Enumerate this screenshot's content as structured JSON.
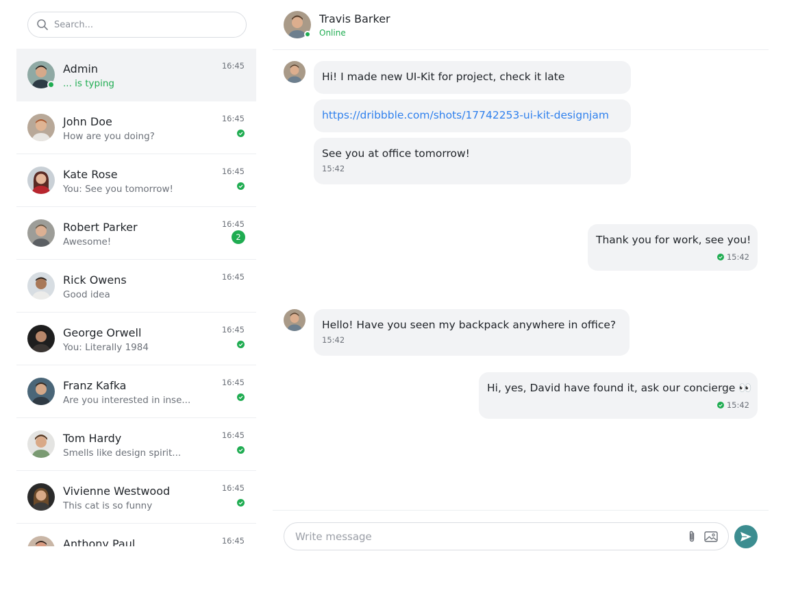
{
  "search": {
    "placeholder": "Search..."
  },
  "chats": [
    {
      "name": "Admin",
      "preview": "... is typing",
      "time": "16:45",
      "typing": true,
      "online": true,
      "status": "none"
    },
    {
      "name": "John Doe",
      "preview": "How are you doing?",
      "time": "16:45",
      "status": "read"
    },
    {
      "name": "Kate Rose",
      "preview": "You: See you tomorrow!",
      "time": "16:45",
      "status": "read"
    },
    {
      "name": "Robert Parker",
      "preview": "Awesome!",
      "time": "16:45",
      "status": "unread",
      "unread_count": "2"
    },
    {
      "name": "Rick Owens",
      "preview": "Good idea",
      "time": "16:45",
      "status": "none"
    },
    {
      "name": "George Orwell",
      "preview": "You: Literally 1984",
      "time": "16:45",
      "status": "read"
    },
    {
      "name": "Franz Kafka",
      "preview": "Are you interested in inse...",
      "time": "16:45",
      "status": "read"
    },
    {
      "name": "Tom Hardy",
      "preview": "Smells like design spirit...",
      "time": "16:45",
      "status": "read"
    },
    {
      "name": "Vivienne Westwood",
      "preview": "This cat is so funny",
      "time": "16:45",
      "status": "read"
    },
    {
      "name": "Anthony Paul",
      "preview": "",
      "time": "16:45",
      "status": "none"
    }
  ],
  "header": {
    "name": "Travis Barker",
    "status": "Online"
  },
  "messages": [
    {
      "text": "Hi! I made new UI-Kit for project, check it late",
      "time": ""
    },
    {
      "text": "https://dribbble.com/shots/17742253-ui-kit-designjam",
      "time": ""
    },
    {
      "text": "See you at office tomorrow!",
      "time": "15:42"
    },
    {
      "text": "Thank you for work, see you!",
      "time": "15:42"
    },
    {
      "text": "Hello! Have you seen my backpack anywhere in office?",
      "time": "15:42"
    },
    {
      "text": "Hi, yes, David have found it, ask our concierge 👀",
      "time": "15:42"
    }
  ],
  "composer": {
    "placeholder": "Write message"
  },
  "colors": {
    "accent": "#1fac51",
    "send": "#3c8d90",
    "link": "#2f80ed",
    "bubble": "#f2f3f5"
  },
  "icons": {
    "search": "search-icon",
    "read": "check-circle-icon",
    "attach": "paperclip-icon",
    "image": "image-icon",
    "send": "send-icon"
  }
}
